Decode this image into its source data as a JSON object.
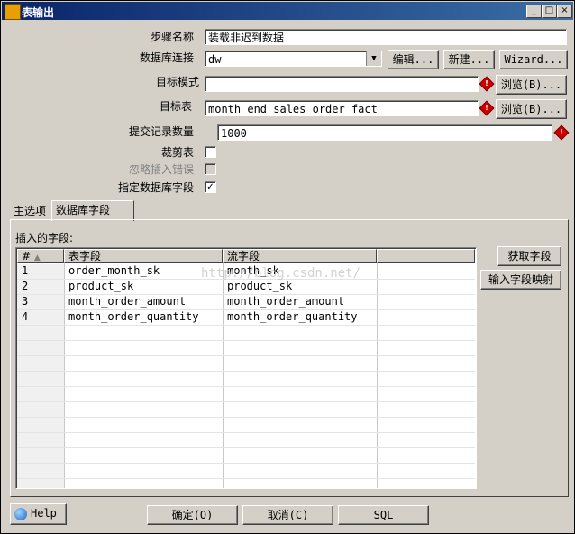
{
  "window": {
    "title": "表输出"
  },
  "form": {
    "step_name": {
      "label": "步骤名称",
      "value": "装载非迟到数据"
    },
    "connection": {
      "label": "数据库连接",
      "value": "dw",
      "edit_label": "编辑...",
      "new_label": "新建...",
      "wizard_label": "Wizard..."
    },
    "target_schema": {
      "label": "目标模式",
      "value": "",
      "browse_label": "浏览(B)..."
    },
    "target_table": {
      "label": "目标表",
      "value": "month_end_sales_order_fact",
      "browse_label": "浏览(B)..."
    },
    "commit_size": {
      "label": "提交记录数量",
      "value": "1000"
    },
    "truncate_table": {
      "label": "裁剪表",
      "checked": false
    },
    "ignore_insert_errors": {
      "label": "忽略插入错误",
      "checked": false,
      "disabled": true
    },
    "specify_db_fields": {
      "label": "指定数据库字段",
      "checked": true
    }
  },
  "tabs": [
    {
      "label": "主选项",
      "active": false
    },
    {
      "label": "数据库字段",
      "active": true
    }
  ],
  "fields_panel": {
    "label": "插入的字段:",
    "columns": [
      "#",
      "表字段",
      "流字段"
    ],
    "rows": [
      {
        "num": "1",
        "table_field": "order_month_sk",
        "stream_field": "month_sk"
      },
      {
        "num": "2",
        "table_field": "product_sk",
        "stream_field": "product_sk"
      },
      {
        "num": "3",
        "table_field": "month_order_amount",
        "stream_field": "month_order_amount"
      },
      {
        "num": "4",
        "table_field": "month_order_quantity",
        "stream_field": "month_order_quantity"
      }
    ],
    "get_fields_label": "获取字段",
    "map_fields_label": "输入字段映射"
  },
  "footer": {
    "help_label": "Help",
    "ok_label": "确定(O)",
    "cancel_label": "取消(C)",
    "sql_label": "SQL"
  },
  "watermark": "http://blog.csdn.net/"
}
